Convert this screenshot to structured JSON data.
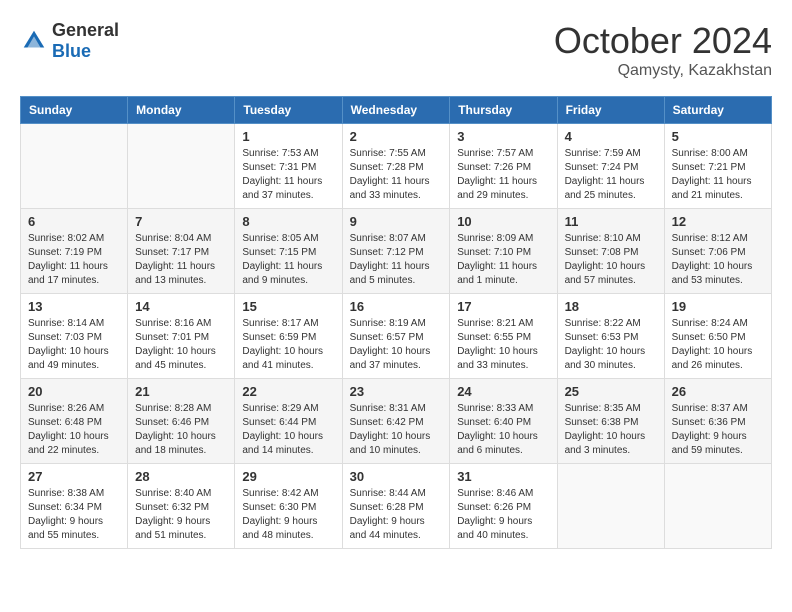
{
  "header": {
    "logo": {
      "text_general": "General",
      "text_blue": "Blue"
    },
    "title": "October 2024",
    "location": "Qamysty, Kazakhstan"
  },
  "weekdays": [
    "Sunday",
    "Monday",
    "Tuesday",
    "Wednesday",
    "Thursday",
    "Friday",
    "Saturday"
  ],
  "weeks": [
    [
      {
        "day": "",
        "empty": true
      },
      {
        "day": "",
        "empty": true
      },
      {
        "day": "1",
        "sunrise": "Sunrise: 7:53 AM",
        "sunset": "Sunset: 7:31 PM",
        "daylight": "Daylight: 11 hours and 37 minutes."
      },
      {
        "day": "2",
        "sunrise": "Sunrise: 7:55 AM",
        "sunset": "Sunset: 7:28 PM",
        "daylight": "Daylight: 11 hours and 33 minutes."
      },
      {
        "day": "3",
        "sunrise": "Sunrise: 7:57 AM",
        "sunset": "Sunset: 7:26 PM",
        "daylight": "Daylight: 11 hours and 29 minutes."
      },
      {
        "day": "4",
        "sunrise": "Sunrise: 7:59 AM",
        "sunset": "Sunset: 7:24 PM",
        "daylight": "Daylight: 11 hours and 25 minutes."
      },
      {
        "day": "5",
        "sunrise": "Sunrise: 8:00 AM",
        "sunset": "Sunset: 7:21 PM",
        "daylight": "Daylight: 11 hours and 21 minutes."
      }
    ],
    [
      {
        "day": "6",
        "sunrise": "Sunrise: 8:02 AM",
        "sunset": "Sunset: 7:19 PM",
        "daylight": "Daylight: 11 hours and 17 minutes."
      },
      {
        "day": "7",
        "sunrise": "Sunrise: 8:04 AM",
        "sunset": "Sunset: 7:17 PM",
        "daylight": "Daylight: 11 hours and 13 minutes."
      },
      {
        "day": "8",
        "sunrise": "Sunrise: 8:05 AM",
        "sunset": "Sunset: 7:15 PM",
        "daylight": "Daylight: 11 hours and 9 minutes."
      },
      {
        "day": "9",
        "sunrise": "Sunrise: 8:07 AM",
        "sunset": "Sunset: 7:12 PM",
        "daylight": "Daylight: 11 hours and 5 minutes."
      },
      {
        "day": "10",
        "sunrise": "Sunrise: 8:09 AM",
        "sunset": "Sunset: 7:10 PM",
        "daylight": "Daylight: 11 hours and 1 minute."
      },
      {
        "day": "11",
        "sunrise": "Sunrise: 8:10 AM",
        "sunset": "Sunset: 7:08 PM",
        "daylight": "Daylight: 10 hours and 57 minutes."
      },
      {
        "day": "12",
        "sunrise": "Sunrise: 8:12 AM",
        "sunset": "Sunset: 7:06 PM",
        "daylight": "Daylight: 10 hours and 53 minutes."
      }
    ],
    [
      {
        "day": "13",
        "sunrise": "Sunrise: 8:14 AM",
        "sunset": "Sunset: 7:03 PM",
        "daylight": "Daylight: 10 hours and 49 minutes."
      },
      {
        "day": "14",
        "sunrise": "Sunrise: 8:16 AM",
        "sunset": "Sunset: 7:01 PM",
        "daylight": "Daylight: 10 hours and 45 minutes."
      },
      {
        "day": "15",
        "sunrise": "Sunrise: 8:17 AM",
        "sunset": "Sunset: 6:59 PM",
        "daylight": "Daylight: 10 hours and 41 minutes."
      },
      {
        "day": "16",
        "sunrise": "Sunrise: 8:19 AM",
        "sunset": "Sunset: 6:57 PM",
        "daylight": "Daylight: 10 hours and 37 minutes."
      },
      {
        "day": "17",
        "sunrise": "Sunrise: 8:21 AM",
        "sunset": "Sunset: 6:55 PM",
        "daylight": "Daylight: 10 hours and 33 minutes."
      },
      {
        "day": "18",
        "sunrise": "Sunrise: 8:22 AM",
        "sunset": "Sunset: 6:53 PM",
        "daylight": "Daylight: 10 hours and 30 minutes."
      },
      {
        "day": "19",
        "sunrise": "Sunrise: 8:24 AM",
        "sunset": "Sunset: 6:50 PM",
        "daylight": "Daylight: 10 hours and 26 minutes."
      }
    ],
    [
      {
        "day": "20",
        "sunrise": "Sunrise: 8:26 AM",
        "sunset": "Sunset: 6:48 PM",
        "daylight": "Daylight: 10 hours and 22 minutes."
      },
      {
        "day": "21",
        "sunrise": "Sunrise: 8:28 AM",
        "sunset": "Sunset: 6:46 PM",
        "daylight": "Daylight: 10 hours and 18 minutes."
      },
      {
        "day": "22",
        "sunrise": "Sunrise: 8:29 AM",
        "sunset": "Sunset: 6:44 PM",
        "daylight": "Daylight: 10 hours and 14 minutes."
      },
      {
        "day": "23",
        "sunrise": "Sunrise: 8:31 AM",
        "sunset": "Sunset: 6:42 PM",
        "daylight": "Daylight: 10 hours and 10 minutes."
      },
      {
        "day": "24",
        "sunrise": "Sunrise: 8:33 AM",
        "sunset": "Sunset: 6:40 PM",
        "daylight": "Daylight: 10 hours and 6 minutes."
      },
      {
        "day": "25",
        "sunrise": "Sunrise: 8:35 AM",
        "sunset": "Sunset: 6:38 PM",
        "daylight": "Daylight: 10 hours and 3 minutes."
      },
      {
        "day": "26",
        "sunrise": "Sunrise: 8:37 AM",
        "sunset": "Sunset: 6:36 PM",
        "daylight": "Daylight: 9 hours and 59 minutes."
      }
    ],
    [
      {
        "day": "27",
        "sunrise": "Sunrise: 8:38 AM",
        "sunset": "Sunset: 6:34 PM",
        "daylight": "Daylight: 9 hours and 55 minutes."
      },
      {
        "day": "28",
        "sunrise": "Sunrise: 8:40 AM",
        "sunset": "Sunset: 6:32 PM",
        "daylight": "Daylight: 9 hours and 51 minutes."
      },
      {
        "day": "29",
        "sunrise": "Sunrise: 8:42 AM",
        "sunset": "Sunset: 6:30 PM",
        "daylight": "Daylight: 9 hours and 48 minutes."
      },
      {
        "day": "30",
        "sunrise": "Sunrise: 8:44 AM",
        "sunset": "Sunset: 6:28 PM",
        "daylight": "Daylight: 9 hours and 44 minutes."
      },
      {
        "day": "31",
        "sunrise": "Sunrise: 8:46 AM",
        "sunset": "Sunset: 6:26 PM",
        "daylight": "Daylight: 9 hours and 40 minutes."
      },
      {
        "day": "",
        "empty": true
      },
      {
        "day": "",
        "empty": true
      }
    ]
  ]
}
